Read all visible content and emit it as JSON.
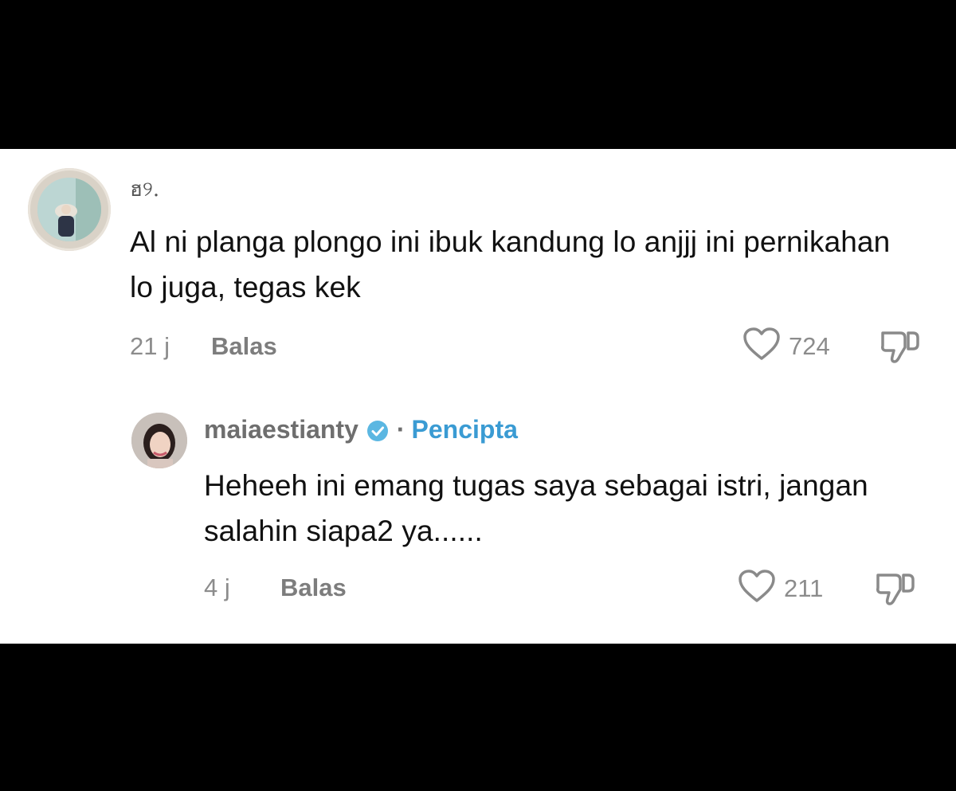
{
  "comments": [
    {
      "username": "ฮ୨.",
      "text": "Al ni planga plongo ini ibuk kandung lo anjjj ini pernikahan lo juga, tegas kek",
      "time": "21 j",
      "reply_label": "Balas",
      "likes": "724"
    },
    {
      "username": "maiaestianty",
      "verified": true,
      "separator": "·",
      "role_label": "Pencipta",
      "text": "Heheeh ini emang tugas saya sebagai istri, jangan salahin siapa2 ya......",
      "time": "4 j",
      "reply_label": "Balas",
      "likes": "211"
    }
  ],
  "colors": {
    "creator": "#3a9bd3",
    "verified_badge": "#5bb7e2",
    "text": "#111111",
    "meta": "#8c8c8c",
    "background_frame": "#000000",
    "panel": "#ffffff"
  },
  "icons": [
    "heart-icon",
    "thumbs-down-icon",
    "verified-badge-icon"
  ]
}
